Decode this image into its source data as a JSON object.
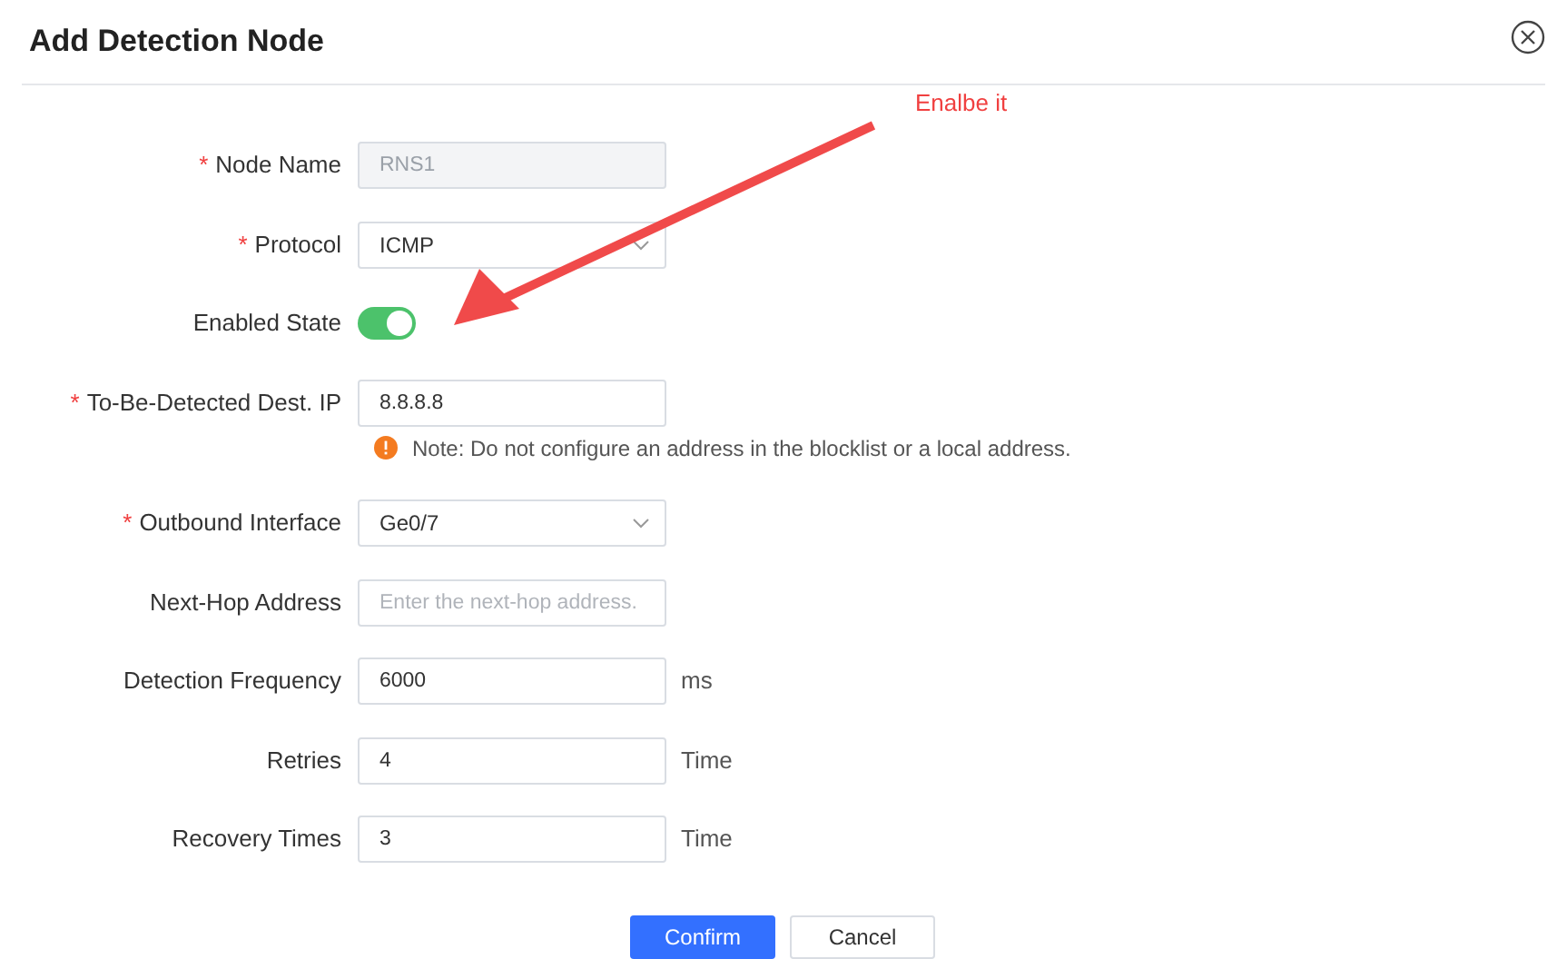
{
  "dialog": {
    "title": "Add Detection Node"
  },
  "annotation": {
    "text": "Enalbe it"
  },
  "fields": [
    {
      "kind": "input",
      "required_mark": "*",
      "label": "Node Name",
      "value": "RNS1",
      "disabled": true
    },
    {
      "kind": "select",
      "required_mark": "*",
      "label": "Protocol",
      "value": "ICMP"
    },
    {
      "kind": "switch",
      "label": "Enabled State",
      "on": true
    },
    {
      "kind": "input",
      "required_mark": "*",
      "label": "To-Be-Detected Dest. IP",
      "value": "8.8.8.8",
      "note": "Note: Do not configure an address in the blocklist or a local address."
    },
    {
      "kind": "select",
      "required_mark": "*",
      "label": "Outbound Interface",
      "value": "Ge0/7"
    },
    {
      "kind": "input",
      "label": "Next-Hop Address",
      "placeholder": "Enter the next-hop address."
    },
    {
      "kind": "input",
      "label": "Detection Frequency",
      "value": "6000",
      "unit": "ms"
    },
    {
      "kind": "input",
      "label": "Retries",
      "value": "4",
      "unit": "Time"
    },
    {
      "kind": "input",
      "label": "Recovery Times",
      "value": "3",
      "unit": "Time"
    }
  ],
  "buttons": [
    {
      "label": "Confirm",
      "kind": "primary"
    },
    {
      "label": "Cancel",
      "kind": "default"
    }
  ]
}
